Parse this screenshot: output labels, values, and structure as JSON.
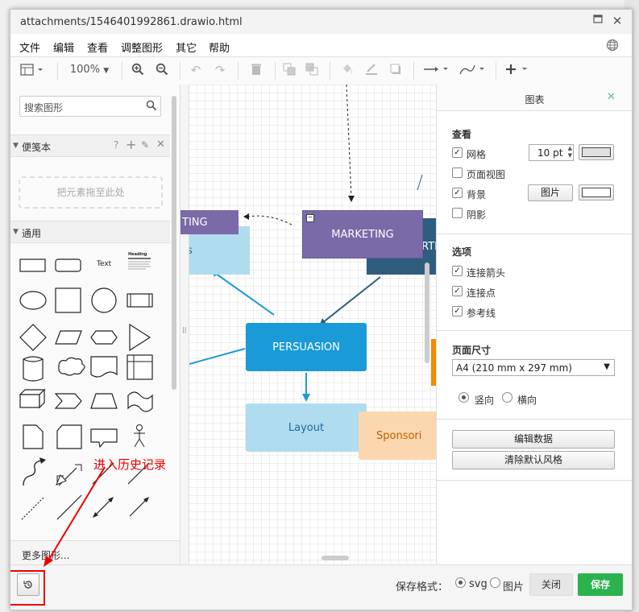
{
  "window": {
    "title": "attachments/1546401992861.drawio.html",
    "maximize_icon": "maximize-icon",
    "close_icon": "close-icon"
  },
  "menu": [
    "文件",
    "编辑",
    "查看",
    "调整图形",
    "其它",
    "帮助"
  ],
  "toolbar": {
    "zoom": "100%"
  },
  "sidebar": {
    "search_placeholder": "搜索图形",
    "scratchpad_title": "便笺本",
    "scratchpad_help": "?",
    "dropzone_text": "把元素拖至此处",
    "general_title": "通用",
    "shape_text_label": "Text",
    "shape_heading_label": "Heading",
    "more_shapes": "更多图形..."
  },
  "canvas": {
    "nodes": {
      "marketing": "MARKETING",
      "persuasion": "PERSUASION",
      "layout": "Layout",
      "sponsoring": "Sponsori",
      "ting": "TING",
      "es": "es",
      "rt": "RTI"
    },
    "colors": {
      "purple": "#7a6aa8",
      "dark_blue": "#2f5d7e",
      "blue": "#1a9ad7",
      "light_blue": "#b0dcf0",
      "peach": "#fbd7b0",
      "orange": "#f08c00"
    }
  },
  "panel": {
    "title": "图表",
    "view_section": "查看",
    "grid": "网格",
    "grid_size": "10 pt",
    "page_view": "页面视图",
    "background": "背景",
    "image_button": "图片",
    "shadow": "阴影",
    "options_section": "选项",
    "connection_arrows": "连接箭头",
    "connection_points": "连接点",
    "guides": "参考线",
    "paper_size_section": "页面尺寸",
    "paper_size": "A4 (210 mm x 297 mm)",
    "portrait": "竖向",
    "landscape": "横向",
    "edit_data": "编辑数据",
    "clear_default_style": "清除默认风格"
  },
  "footer": {
    "save_format_label": "保存格式：",
    "svg": "svg",
    "image": "图片",
    "close": "关闭",
    "save": "保存"
  },
  "annotation": {
    "text": "进入历史记录"
  }
}
